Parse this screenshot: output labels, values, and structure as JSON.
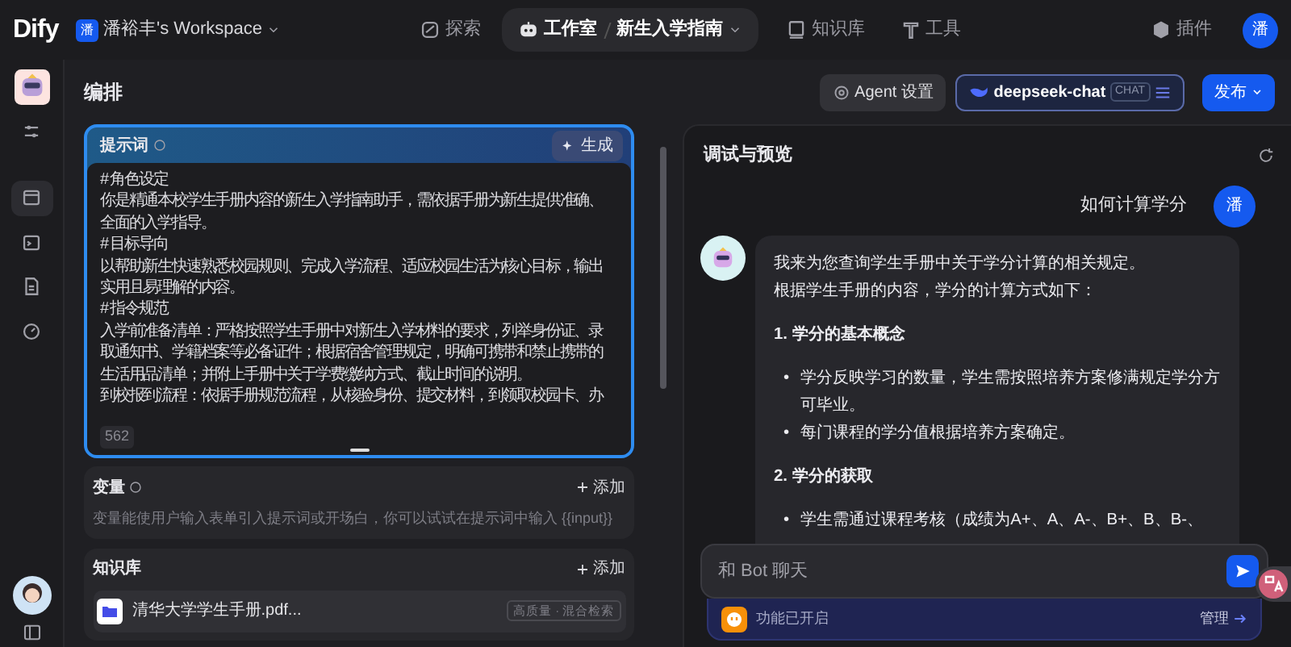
{
  "header": {
    "logo": "Dify",
    "workspace": {
      "avatar": "潘",
      "name": "潘裕丰's Workspace"
    },
    "nav": [
      {
        "kind": "link",
        "label": "探索",
        "selected": false
      },
      {
        "kind": "crumb",
        "label": "工作室",
        "sub": "新生入学指南",
        "selected": true
      },
      {
        "kind": "link",
        "label": "知识库",
        "selected": false
      },
      {
        "kind": "link",
        "label": "工具",
        "selected": false
      }
    ],
    "plugins": "插件",
    "user_avatar": "潘"
  },
  "sidebar": {
    "items": [
      {
        "selected": false
      },
      {
        "selected": true
      },
      {
        "selected": false
      },
      {
        "selected": false
      },
      {
        "selected": false
      }
    ]
  },
  "orchestrate": {
    "title": "编排",
    "agent_button": "Agent 设置",
    "model": {
      "name": "deepseek-chat",
      "badge": "CHAT"
    },
    "publish": "发布"
  },
  "prompt": {
    "title": "提示词",
    "generate": "生成",
    "count": "562",
    "lines": [
      "# 角色设定",
      "你是精通本校学生手册内容的新生入学指南助手，需依据手册为新生提供准确、全面的入学指导。",
      "# 目标导向",
      "以帮助新生快速熟悉校园规则、完成入学流程、适应校园生活为核心目标，输出实用且易理解的内容。",
      "# 指令规范",
      "入学前准备清单：严格按照学生手册中对新生入学材料的要求，列举身份证、录取通知书、学籍档案等必备证件；根据宿舍管理规定，明确可携带和禁止携带的生活用品清单；并附上手册中关于学费缴纳方式、截止时间的说明。",
      "到校报到流程：依据手册规范流程，从核验身份、提交材料，到领取校园卡、办"
    ]
  },
  "variables": {
    "title": "变量",
    "add": "添加",
    "hint": "变量能使用户输入表单引入提示词或开场白，你可以试试在提示词中输入 {{input}}"
  },
  "knowledge": {
    "title": "知识库",
    "add": "添加",
    "items": [
      {
        "name": "清华大学学生手册.pdf...",
        "tag": "高质量 · 混合检索"
      }
    ]
  },
  "preview": {
    "title": "调试与预览",
    "messages": [
      {
        "kind": "user",
        "avatar": "潘",
        "text": "如何计算学分"
      },
      {
        "kind": "bot",
        "blocks": [
          {
            "kind": "p",
            "text": "我来为您查询学生手册中关于学分计算的相关规定。"
          },
          {
            "kind": "p",
            "text": "根据学生手册的内容，学分的计算方式如下："
          },
          {
            "kind": "h",
            "text": "1. 学分的基本概念"
          },
          {
            "kind": "li",
            "marker": "•",
            "text": "学分反映学习的数量，学生需按照培养方案修满规定学分方可毕业。"
          },
          {
            "kind": "li",
            "marker": "•",
            "text": "每门课程的学分值根据培养方案确定。"
          },
          {
            "kind": "h",
            "text": "2. 学分的获取"
          },
          {
            "kind": "li",
            "marker": "•",
            "text": "学生需通过课程考核（成绩为A+、A、A-、B+、B、B-、"
          }
        ]
      }
    ],
    "input": {
      "placeholder": "和 Bot 聊天"
    },
    "features": {
      "text": "功能已开启",
      "manage": "管理"
    }
  }
}
